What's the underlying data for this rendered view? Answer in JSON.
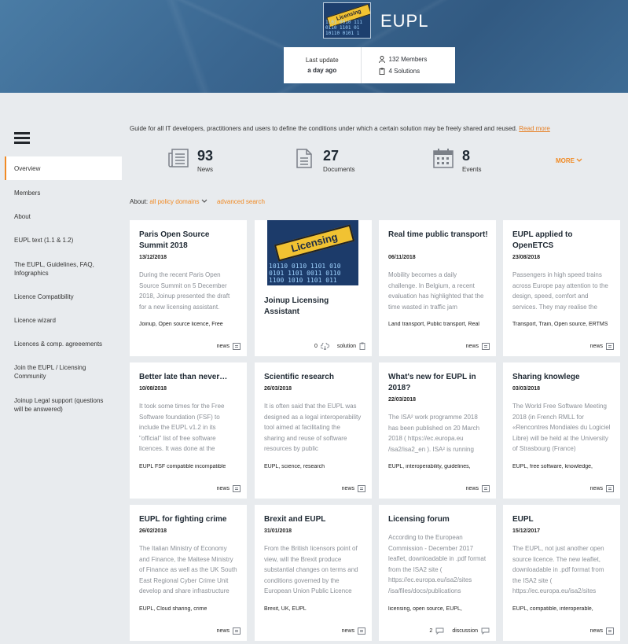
{
  "header": {
    "title": "EUPL",
    "logo_text": "Licensing",
    "last_update_label": "Last update",
    "last_update_value": "a day ago",
    "members": "132 Members",
    "solutions": "4 Solutions"
  },
  "sidebar": {
    "items": [
      {
        "label": "Overview",
        "active": true
      },
      {
        "label": "Members"
      },
      {
        "label": "About"
      },
      {
        "label": "EUPL text (1.1 & 1.2)"
      },
      {
        "label": "The EUPL, Guidelines, FAQ, Infographics"
      },
      {
        "label": "Licence Compatibility"
      },
      {
        "label": "Licence wizard"
      },
      {
        "label": "Licences & comp. agreeements"
      },
      {
        "label": "Join the EUPL / Licensing Community"
      },
      {
        "label": "Joinup Legal support (questions will be answered)"
      }
    ]
  },
  "intro": {
    "text": "Guide for all IT developers, practitioners and users to define the conditions under which a certain solution may be freely shared and reused.",
    "read_more": "Read more"
  },
  "stats": [
    {
      "num": "93",
      "label": "News",
      "icon": "news-icon"
    },
    {
      "num": "27",
      "label": "Documents",
      "icon": "document-icon"
    },
    {
      "num": "8",
      "label": "Events",
      "icon": "calendar-icon"
    }
  ],
  "more_label": "MORE",
  "filter": {
    "about_label": "About:",
    "policy_domains": "all policy domains",
    "advanced_search": "advanced search"
  },
  "cards": [
    {
      "title": "Paris Open Source Summit 2018",
      "date": "13/12/2018",
      "text": "During the recent Paris Open Source Summit on 5 December 2018, Joinup presented the draft for a new licensing assistant.",
      "tags": "Joinup, Open source licence, Free",
      "type": "news"
    },
    {
      "title": "Joinup Licensing Assistant",
      "date": "",
      "text": "",
      "tags": "",
      "type": "solution",
      "count": "0",
      "image_text": "Licensing"
    },
    {
      "title": "Real time public transport!",
      "date": "06/11/2018",
      "text": "Mobility becomes a daily challenge. In Belgium, a recent evaluation has highlighted that the time wasted in traffic jam",
      "tags": "Land transport, Public transport, Real",
      "type": "news"
    },
    {
      "title": "EUPL applied to OpenETCS",
      "date": "23/08/2018",
      "text": "Passengers in high speed trains across Europe pay attention to the design, speed, comfort and services. They may realise the",
      "tags": "Transport, Train, Open source, ERTMS",
      "type": "news"
    },
    {
      "title": "Better late than never…",
      "date": "10/08/2018",
      "text": "It took some times for the Free Software foundation (FSF) to include the EUPL v1.2 in its \"official\" list of free software licences. It was done at the",
      "tags": "EUPL FSF compatible incompatible",
      "type": "news"
    },
    {
      "title": "Scientific research",
      "date": "26/03/2018",
      "text": "It is often said that the EUPL was designed as a legal interoperability tool aimed at facilitating the sharing and reuse of software resources by public",
      "tags": "EUPL, science, research",
      "type": "news"
    },
    {
      "title": "What's new for EUPL in 2018?",
      "date": "22/03/2018",
      "text": "The ISA² work programme 2018 has been published on 20 March 2018 ( https://ec.europa.eu /isa2/isa2_en ). ISA² is running",
      "tags": "EUPL, interoperability, guidelines,",
      "type": "news"
    },
    {
      "title": "Sharing knowlege",
      "date": "03/03/2018",
      "text": "The World Free Software Meeting 2018 (in French RMLL for «Rencontres Mondiales du Logiciel Libre) will be held at the University of Strasbourg (France)",
      "tags": "EUPL, free software, knowledge,",
      "type": "news"
    },
    {
      "title": "EUPL for fighting crime",
      "date": "26/02/2018",
      "text": "The Italian Ministry of Economy and Finance, the Maltese Ministry of Finance as well as the UK South East Regional Cyber Crime Unit develop and share infrastructure",
      "tags": "EUPL, Cloud sharing, crime",
      "type": "news"
    },
    {
      "title": "Brexit and EUPL",
      "date": "31/01/2018",
      "text": "From the British licensors point of view, will the Brexit produce substantial changes on terms and conditions governed by the European Union Public Licence",
      "tags": "Brexit, UK, EUPL",
      "type": "news"
    },
    {
      "title": "Licensing forum",
      "date": "",
      "text": "According to the European Commission - December 2017 leaflet, downloadable in .pdf format from the ISA2 site ( https://ec.europa.eu/isa2/sites /isa/files/docs/publications",
      "tags": "licensing, open source, EUPL,",
      "type": "discussion",
      "count": "2"
    },
    {
      "title": "EUPL",
      "date": "15/12/2017",
      "text": "The EUPL, not just another open source licence. The new leaflet, downloadable in .pdf format from the ISA2 site ( https://ec.europa.eu/isa2/sites",
      "tags": "EUPL, compatible, interoperable,",
      "type": "news"
    }
  ],
  "colors": {
    "accent": "#f08a24",
    "banner": "#3a6690",
    "page_bg": "#e8ebee"
  }
}
